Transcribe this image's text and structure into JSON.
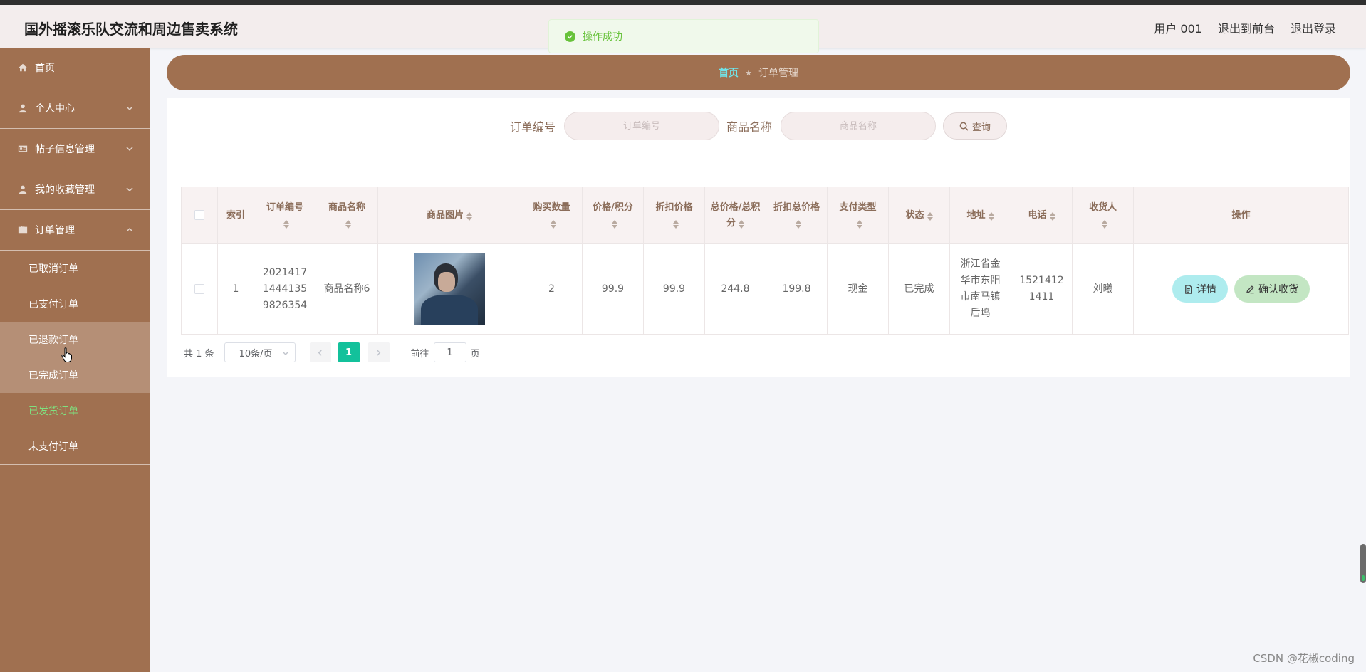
{
  "app": {
    "title": "国外摇滚乐队交流和周边售卖系统"
  },
  "header": {
    "user": "用户 001",
    "to_front": "退出到前台",
    "logout": "退出登录"
  },
  "toast": {
    "message": "操作成功",
    "color": "#67c23a"
  },
  "sidebar": {
    "items": [
      {
        "label": "首页",
        "icon": "home-icon"
      },
      {
        "label": "个人中心",
        "icon": "user-icon"
      },
      {
        "label": "帖子信息管理",
        "icon": "post-icon"
      },
      {
        "label": "我的收藏管理",
        "icon": "user-icon"
      },
      {
        "label": "订单管理",
        "icon": "bag-icon"
      }
    ],
    "order_sub": [
      {
        "label": "已取消订单"
      },
      {
        "label": "已支付订单"
      },
      {
        "label": "已退款订单"
      },
      {
        "label": "已完成订单"
      },
      {
        "label": "已发货订单"
      },
      {
        "label": "未支付订单"
      }
    ],
    "bg_color": "#a07050",
    "active_color": "#7fe07f"
  },
  "breadcrumb": {
    "home": "首页",
    "sep": "★",
    "current": "订单管理"
  },
  "search": {
    "order_no_label": "订单编号",
    "order_no_placeholder": "订单编号",
    "product_name_label": "商品名称",
    "product_name_placeholder": "商品名称",
    "button": "查询"
  },
  "table": {
    "columns": {
      "index": "索引",
      "order_no": "订单编号",
      "product_name": "商品名称",
      "product_image": "商品图片",
      "quantity": "购买数量",
      "price": "价格/积分",
      "discount_price": "折扣价格",
      "total": "总价格/总积分",
      "discount_total": "折扣总价格",
      "pay_type": "支付类型",
      "status": "状态",
      "address": "地址",
      "phone": "电话",
      "receiver": "收货人",
      "ops": "操作"
    },
    "rows": [
      {
        "index": "1",
        "order_no": "20214171444135 9826354",
        "product_name": "商品名称6",
        "quantity": "2",
        "price": "99.9",
        "discount_price": "99.9",
        "total": "244.8",
        "discount_total": "199.8",
        "pay_type": "现金",
        "status": "已完成",
        "address": "浙江省金华市东阳市南马镇后坞",
        "phone": "15214121411",
        "receiver": "刘曦",
        "detail_btn": "详情",
        "confirm_btn": "确认收货"
      }
    ]
  },
  "pagination": {
    "total": "共 1 条",
    "page_size": "10条/页",
    "current": "1",
    "goto_label": "前往",
    "goto_value": "1",
    "page_suffix": "页",
    "accent": "#13c19b"
  },
  "watermark": "CSDN @花椒coding"
}
